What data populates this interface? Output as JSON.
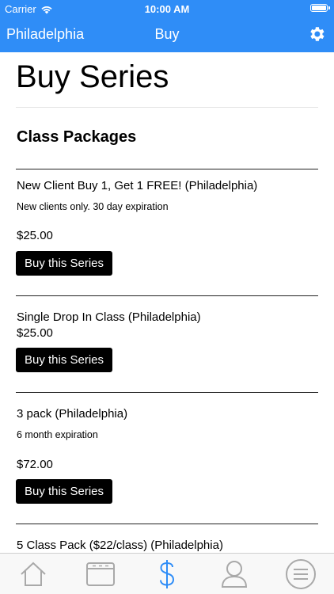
{
  "status_bar": {
    "carrier": "Carrier",
    "time": "10:00 AM"
  },
  "nav": {
    "left_label": "Philadelphia",
    "title": "Buy",
    "settings_icon": "gear-icon"
  },
  "page": {
    "title": "Buy Series",
    "section_title": "Class Packages"
  },
  "packages": [
    {
      "name": "New Client Buy 1, Get 1 FREE! (Philadelphia)",
      "description": "New clients only. 30 day expiration",
      "price": "$25.00",
      "button_label": "Buy this Series"
    },
    {
      "name": "Single Drop In Class (Philadelphia)",
      "description": "",
      "price": "$25.00",
      "button_label": "Buy this Series"
    },
    {
      "name": "3 pack (Philadelphia)",
      "description": "6 month expiration",
      "price": "$72.00",
      "button_label": "Buy this Series"
    },
    {
      "name": "5 Class Pack ($22/class) (Philadelphia)",
      "description": "",
      "price": "",
      "button_label": ""
    }
  ],
  "tabs": [
    {
      "icon": "home-icon",
      "active": false
    },
    {
      "icon": "schedule-icon",
      "active": false
    },
    {
      "icon": "dollar-icon",
      "active": true
    },
    {
      "icon": "profile-icon",
      "active": false
    },
    {
      "icon": "menu-icon",
      "active": false
    }
  ],
  "colors": {
    "header": "#2f8df7",
    "tab_active": "#2f8df7",
    "tab_inactive": "#a9a9a9",
    "button": "#000000"
  }
}
